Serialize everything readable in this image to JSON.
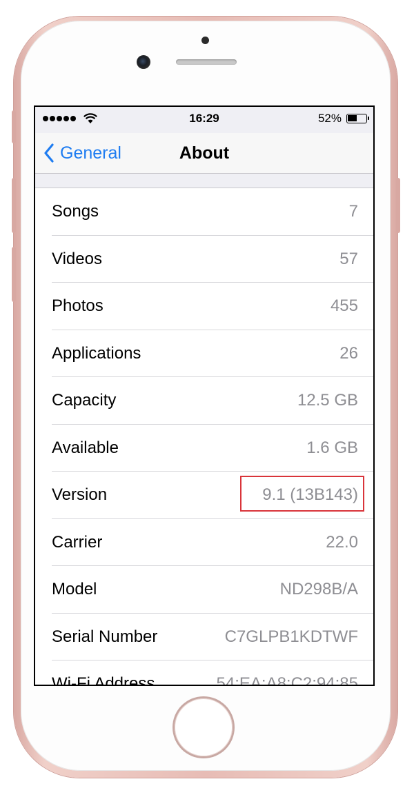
{
  "status_bar": {
    "time": "16:29",
    "battery_percent": "52%",
    "battery_level": 0.52,
    "signal_bars": 5
  },
  "nav": {
    "back_label": "General",
    "title": "About"
  },
  "rows": [
    {
      "label": "Songs",
      "value": "7"
    },
    {
      "label": "Videos",
      "value": "57"
    },
    {
      "label": "Photos",
      "value": "455"
    },
    {
      "label": "Applications",
      "value": "26"
    },
    {
      "label": "Capacity",
      "value": "12.5 GB"
    },
    {
      "label": "Available",
      "value": "1.6 GB"
    },
    {
      "label": "Version",
      "value": "9.1 (13B143)"
    },
    {
      "label": "Carrier",
      "value": "22.0"
    },
    {
      "label": "Model",
      "value": "ND298B/A"
    },
    {
      "label": "Serial Number",
      "value": "C7GLPB1KDTWF"
    },
    {
      "label": "Wi-Fi Address",
      "value": "54:EA:A8:C2:94:85"
    }
  ],
  "colors": {
    "accent": "#1e7cf1",
    "highlight": "#d9343a",
    "phone": "#e7bcb5"
  },
  "icons": [
    "signal-dots-icon",
    "wifi-icon",
    "battery-icon",
    "chevron-left-icon"
  ]
}
